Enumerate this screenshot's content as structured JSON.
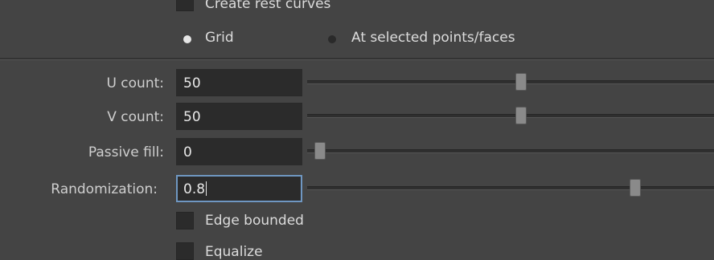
{
  "options": {
    "create_rest_curves": "Create rest curves",
    "grid": "Grid",
    "at_selected": "At selected points/faces",
    "edge_bounded": "Edge bounded",
    "equalize": "Equalize"
  },
  "fields": [
    {
      "label": "U count:",
      "value": "50",
      "slider_fraction": 0.51
    },
    {
      "label": "V count:",
      "value": "50",
      "slider_fraction": 0.51
    },
    {
      "label": "Passive fill:",
      "value": "0",
      "slider_fraction": 0.0
    },
    {
      "label": "Randomization:",
      "value": "0.8",
      "slider_fraction": 0.8
    }
  ],
  "colors": {
    "background": "#444444",
    "field": "#2b2b2b",
    "focus": "#6f97c2",
    "radio_on": "#e6e6e6",
    "radio_off": "#2a2a2a"
  }
}
